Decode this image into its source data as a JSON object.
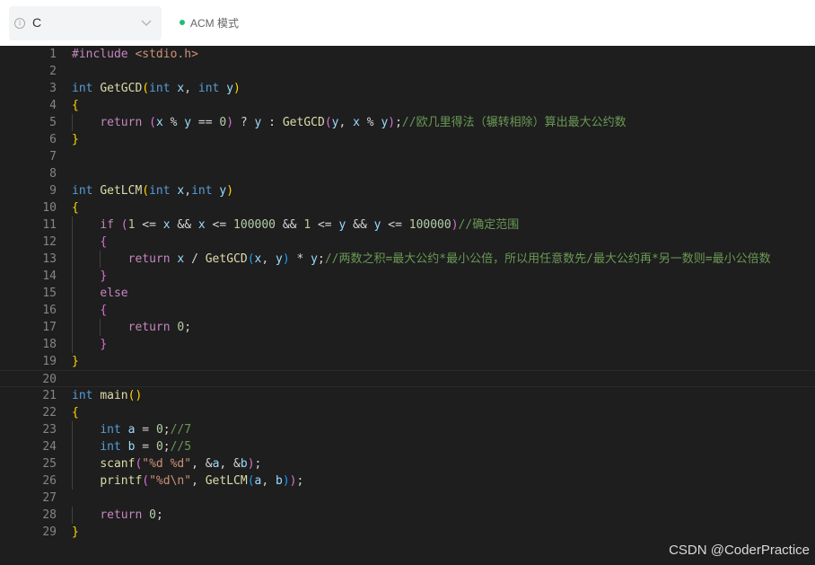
{
  "toolbar": {
    "info_icon": "i",
    "language": "C",
    "mode_label": "ACM 模式",
    "mode_dot_color": "#1ebf73"
  },
  "editor": {
    "line_numbers": [
      "1",
      "2",
      "3",
      "4",
      "5",
      "6",
      "7",
      "8",
      "9",
      "10",
      "11",
      "12",
      "13",
      "14",
      "15",
      "16",
      "17",
      "18",
      "19",
      "20",
      "21",
      "22",
      "23",
      "24",
      "25",
      "26",
      "27",
      "28",
      "29"
    ]
  },
  "code": [
    [
      {
        "t": "#include ",
        "c": "ctl"
      },
      {
        "t": "<stdio.h>",
        "c": "str"
      }
    ],
    [],
    [
      {
        "t": "int ",
        "c": "kw"
      },
      {
        "t": "GetGCD",
        "c": "fn"
      },
      {
        "t": "(",
        "c": "b1"
      },
      {
        "t": "int ",
        "c": "kw"
      },
      {
        "t": "x",
        "c": "var"
      },
      {
        "t": ", "
      },
      {
        "t": "int ",
        "c": "kw"
      },
      {
        "t": "y",
        "c": "var"
      },
      {
        "t": ")",
        "c": "b1"
      }
    ],
    [
      {
        "t": "{",
        "c": "b1"
      }
    ],
    [
      {
        "t": "    "
      },
      {
        "t": "return ",
        "c": "ctl"
      },
      {
        "t": "(",
        "c": "b2"
      },
      {
        "t": "x",
        "c": "var"
      },
      {
        "t": " % "
      },
      {
        "t": "y",
        "c": "var"
      },
      {
        "t": " == "
      },
      {
        "t": "0",
        "c": "num"
      },
      {
        "t": ")",
        "c": "b2"
      },
      {
        "t": " ? "
      },
      {
        "t": "y",
        "c": "var"
      },
      {
        "t": " : "
      },
      {
        "t": "GetGCD",
        "c": "fn"
      },
      {
        "t": "(",
        "c": "b2"
      },
      {
        "t": "y",
        "c": "var"
      },
      {
        "t": ", "
      },
      {
        "t": "x",
        "c": "var"
      },
      {
        "t": " % "
      },
      {
        "t": "y",
        "c": "var"
      },
      {
        "t": ")",
        "c": "b2"
      },
      {
        "t": ";"
      },
      {
        "t": "//欧几里得法（辗转相除）算出最大公约数",
        "c": "cm"
      }
    ],
    [
      {
        "t": "}",
        "c": "b1"
      }
    ],
    [],
    [],
    [
      {
        "t": "int ",
        "c": "kw"
      },
      {
        "t": "GetLCM",
        "c": "fn"
      },
      {
        "t": "(",
        "c": "b1"
      },
      {
        "t": "int ",
        "c": "kw"
      },
      {
        "t": "x",
        "c": "var"
      },
      {
        "t": ","
      },
      {
        "t": "int ",
        "c": "kw"
      },
      {
        "t": "y",
        "c": "var"
      },
      {
        "t": ")",
        "c": "b1"
      }
    ],
    [
      {
        "t": "{",
        "c": "b1"
      }
    ],
    [
      {
        "t": "    "
      },
      {
        "t": "if ",
        "c": "ctl"
      },
      {
        "t": "(",
        "c": "b2"
      },
      {
        "t": "1",
        "c": "num"
      },
      {
        "t": " <= "
      },
      {
        "t": "x",
        "c": "var"
      },
      {
        "t": " && "
      },
      {
        "t": "x",
        "c": "var"
      },
      {
        "t": " <= "
      },
      {
        "t": "100000",
        "c": "num"
      },
      {
        "t": " && "
      },
      {
        "t": "1",
        "c": "num"
      },
      {
        "t": " <= "
      },
      {
        "t": "y",
        "c": "var"
      },
      {
        "t": " && "
      },
      {
        "t": "y",
        "c": "var"
      },
      {
        "t": " <= "
      },
      {
        "t": "100000",
        "c": "num"
      },
      {
        "t": ")",
        "c": "b2"
      },
      {
        "t": "//确定范围",
        "c": "cm"
      }
    ],
    [
      {
        "t": "    "
      },
      {
        "t": "{",
        "c": "b2"
      }
    ],
    [
      {
        "t": "        "
      },
      {
        "t": "return ",
        "c": "ctl"
      },
      {
        "t": "x",
        "c": "var"
      },
      {
        "t": " / "
      },
      {
        "t": "GetGCD",
        "c": "fn"
      },
      {
        "t": "(",
        "c": "b3"
      },
      {
        "t": "x",
        "c": "var"
      },
      {
        "t": ", "
      },
      {
        "t": "y",
        "c": "var"
      },
      {
        "t": ")",
        "c": "b3"
      },
      {
        "t": " * "
      },
      {
        "t": "y",
        "c": "var"
      },
      {
        "t": ";"
      },
      {
        "t": "//两数之积=最大公约*最小公倍，所以用任意数先/最大公约再*另一数则=最小公倍数",
        "c": "cm"
      }
    ],
    [
      {
        "t": "    "
      },
      {
        "t": "}",
        "c": "b2"
      }
    ],
    [
      {
        "t": "    "
      },
      {
        "t": "else",
        "c": "ctl"
      }
    ],
    [
      {
        "t": "    "
      },
      {
        "t": "{",
        "c": "b2"
      }
    ],
    [
      {
        "t": "        "
      },
      {
        "t": "return ",
        "c": "ctl"
      },
      {
        "t": "0",
        "c": "num"
      },
      {
        "t": ";"
      }
    ],
    [
      {
        "t": "    "
      },
      {
        "t": "}",
        "c": "b2"
      }
    ],
    [
      {
        "t": "}",
        "c": "b1"
      }
    ],
    [],
    [
      {
        "t": "int ",
        "c": "kw"
      },
      {
        "t": "main",
        "c": "fn"
      },
      {
        "t": "()",
        "c": "b1"
      }
    ],
    [
      {
        "t": "{",
        "c": "b1"
      }
    ],
    [
      {
        "t": "    "
      },
      {
        "t": "int ",
        "c": "kw"
      },
      {
        "t": "a",
        "c": "var"
      },
      {
        "t": " = "
      },
      {
        "t": "0",
        "c": "num"
      },
      {
        "t": ";"
      },
      {
        "t": "//7",
        "c": "cm"
      }
    ],
    [
      {
        "t": "    "
      },
      {
        "t": "int ",
        "c": "kw"
      },
      {
        "t": "b",
        "c": "var"
      },
      {
        "t": " = "
      },
      {
        "t": "0",
        "c": "num"
      },
      {
        "t": ";"
      },
      {
        "t": "//5",
        "c": "cm"
      }
    ],
    [
      {
        "t": "    "
      },
      {
        "t": "scanf",
        "c": "fn"
      },
      {
        "t": "(",
        "c": "b2"
      },
      {
        "t": "\"%d %d\"",
        "c": "str"
      },
      {
        "t": ", &"
      },
      {
        "t": "a",
        "c": "var"
      },
      {
        "t": ", &"
      },
      {
        "t": "b",
        "c": "var"
      },
      {
        "t": ")",
        "c": "b2"
      },
      {
        "t": ";"
      }
    ],
    [
      {
        "t": "    "
      },
      {
        "t": "printf",
        "c": "fn"
      },
      {
        "t": "(",
        "c": "b2"
      },
      {
        "t": "\"%d\\n\"",
        "c": "str"
      },
      {
        "t": ", "
      },
      {
        "t": "GetLCM",
        "c": "fn"
      },
      {
        "t": "(",
        "c": "b3"
      },
      {
        "t": "a",
        "c": "var"
      },
      {
        "t": ", "
      },
      {
        "t": "b",
        "c": "var"
      },
      {
        "t": ")",
        "c": "b3"
      },
      {
        "t": ")",
        "c": "b2"
      },
      {
        "t": ";"
      }
    ],
    [],
    [
      {
        "t": "    "
      },
      {
        "t": "return ",
        "c": "ctl"
      },
      {
        "t": "0",
        "c": "num"
      },
      {
        "t": ";"
      }
    ],
    [
      {
        "t": "}",
        "c": "b1"
      }
    ]
  ],
  "watermark": "CSDN @CoderPractice"
}
